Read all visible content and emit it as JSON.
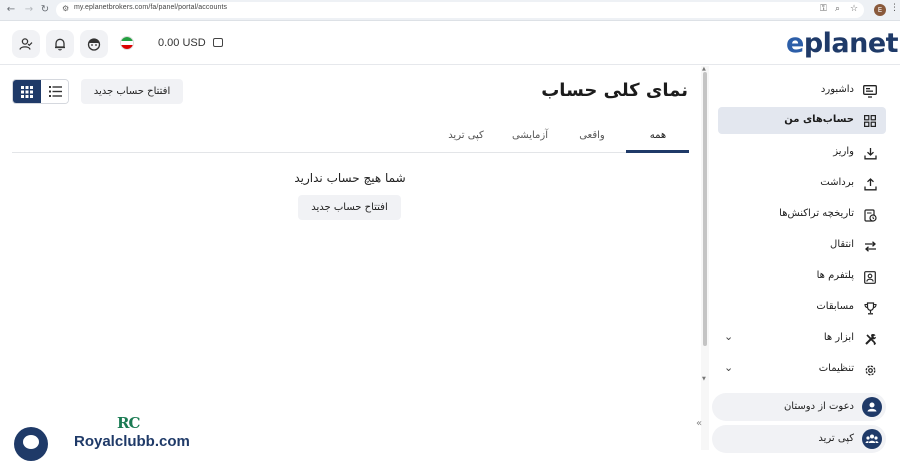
{
  "browser": {
    "url": "my.eplanetbrokers.com/fa/panel/portal/accounts",
    "profile_initial": "E"
  },
  "header": {
    "balance": "0.00 USD",
    "logo_prefix": "e",
    "logo_rest": "planet",
    "accent_color": "#1f3a68"
  },
  "sidebar": {
    "items": [
      {
        "label": "داشبورد",
        "icon": "dashboard-icon"
      },
      {
        "label": "حساب‌های من",
        "icon": "accounts-grid-icon",
        "active": true
      },
      {
        "label": "واریز",
        "icon": "deposit-icon"
      },
      {
        "label": "برداشت",
        "icon": "withdraw-icon"
      },
      {
        "label": "تاریخچه تراکنش‌ها",
        "icon": "history-icon"
      },
      {
        "label": "انتقال",
        "icon": "transfer-icon"
      },
      {
        "label": "پلتفرم ها",
        "icon": "platform-icon"
      },
      {
        "label": "مسابقات",
        "icon": "trophy-icon"
      },
      {
        "label": "ابزار ها",
        "icon": "tools-icon"
      },
      {
        "label": "تنظیمات",
        "icon": "settings-icon"
      }
    ],
    "invite_label": "دعوت از دوستان",
    "copytrade_label": "کپی ترید"
  },
  "main": {
    "title": "نمای کلی حساب",
    "open_account_label": "افتتاح حساب جدید",
    "tabs": [
      {
        "label": "همه",
        "active": true
      },
      {
        "label": "واقعی"
      },
      {
        "label": "آزمایشی"
      },
      {
        "label": "کپی ترید"
      }
    ],
    "empty_message": "شما هیچ حساب ندارید",
    "empty_button_label": "افتتاح حساب جدید"
  },
  "watermark": {
    "monogram": "RC",
    "text": "Royalclubb.com"
  }
}
